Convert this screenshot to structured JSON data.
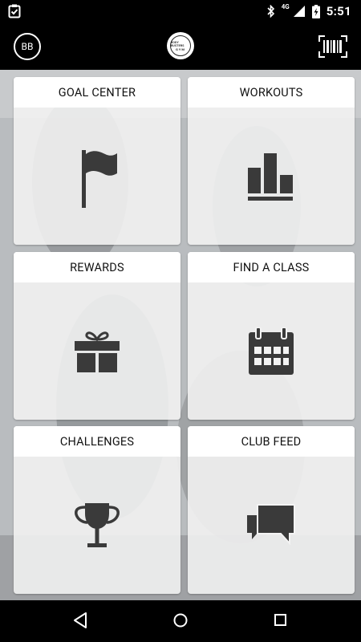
{
  "status": {
    "time": "5:51",
    "network": "4G"
  },
  "header": {
    "avatar_initials": "BB",
    "logo_top_text": "BODY BUSTERS",
    "logo_bottom_text": "GYM"
  },
  "tiles": [
    {
      "label": "GOAL CENTER",
      "icon": "flag-icon"
    },
    {
      "label": "WORKOUTS",
      "icon": "bar-chart-icon"
    },
    {
      "label": "REWARDS",
      "icon": "gift-icon"
    },
    {
      "label": "FIND A CLASS",
      "icon": "calendar-icon"
    },
    {
      "label": "CHALLENGES",
      "icon": "trophy-icon"
    },
    {
      "label": "CLUB FEED",
      "icon": "chat-bubbles-icon"
    }
  ],
  "colors": {
    "icon": "#3a3a3a",
    "tile_header": "#ffffff",
    "bars": "#000000"
  }
}
